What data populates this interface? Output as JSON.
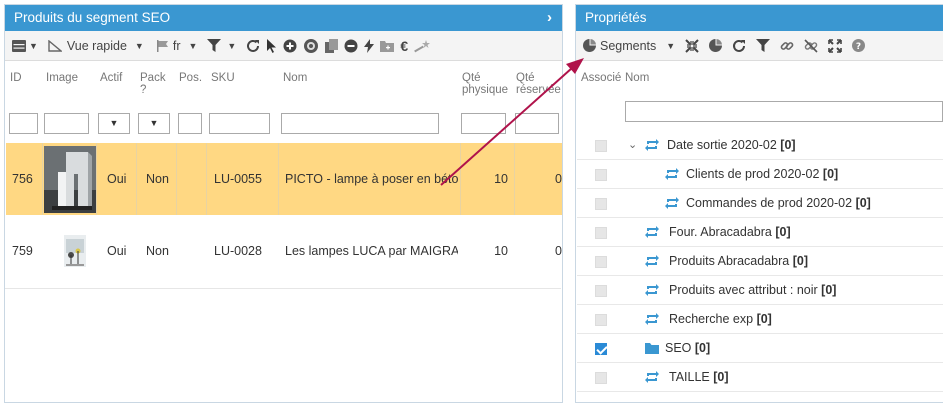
{
  "left": {
    "title": "Produits du segment SEO",
    "toolbar": {
      "view_label": "Vue rapide",
      "lang_label": "fr"
    },
    "columns": {
      "id": "ID",
      "image": "Image",
      "actif": "Actif",
      "pack": "Pack ?",
      "pos": "Pos.",
      "sku": "SKU",
      "nom": "Nom",
      "qte_phys": "Qté physique",
      "qte_res": "Qté réservée"
    },
    "rows": [
      {
        "id": "756",
        "actif": "Oui",
        "pack": "Non",
        "sku": "LU-0055",
        "nom": "PICTO - lampe à poser en béto",
        "qte": "10",
        "res": "0"
      },
      {
        "id": "759",
        "actif": "Oui",
        "pack": "Non",
        "sku": "LU-0028",
        "nom": "Les lampes LUCA par MAIGRA",
        "qte": "10",
        "res": "0"
      }
    ]
  },
  "right": {
    "title": "Propriétés",
    "toolbar": {
      "segments_label": "Segments"
    },
    "columns": {
      "associe": "Associé",
      "nom": "Nom"
    },
    "tree": [
      {
        "label": "Date sortie 2020-02",
        "count": "[0]",
        "checked": false
      },
      {
        "label": "Clients de prod 2020-02",
        "count": "[0]",
        "checked": false
      },
      {
        "label": "Commandes de prod 2020-02",
        "count": "[0]",
        "checked": false
      },
      {
        "label": "Four. Abracadabra",
        "count": "[0]",
        "checked": false
      },
      {
        "label": "Produits Abracadabra",
        "count": "[0]",
        "checked": false
      },
      {
        "label": "Produits avec attribut : noir",
        "count": "[0]",
        "checked": false
      },
      {
        "label": "Recherche exp",
        "count": "[0]",
        "checked": false
      },
      {
        "label": "SEO",
        "count": "[0]",
        "checked": true
      },
      {
        "label": "TAILLE",
        "count": "[0]",
        "checked": false
      }
    ]
  },
  "colors": {
    "header_blue": "#3a97d1",
    "selected_row": "#ffd883",
    "arrow": "#b0134b",
    "icon_blue": "#3a97d1"
  }
}
